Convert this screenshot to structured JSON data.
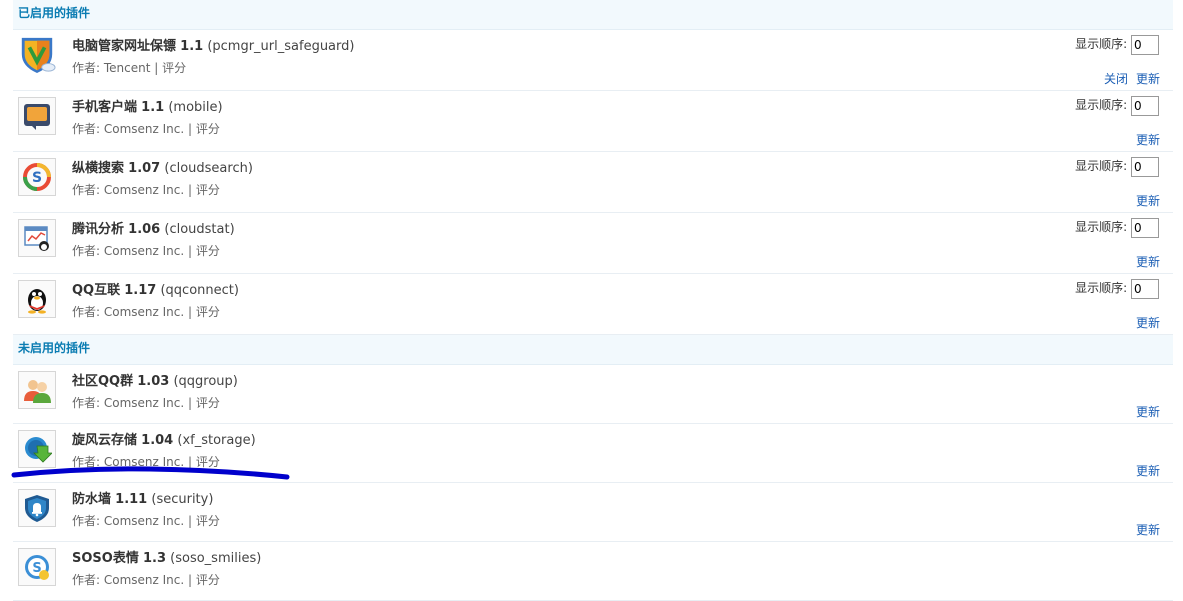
{
  "enabled_section": {
    "title": "已启用的插件"
  },
  "disabled_section": {
    "title": "未启用的插件"
  },
  "labels": {
    "author_prefix": "作者: ",
    "separator": " | ",
    "rating": "评分",
    "order": "显示顺序:",
    "close": "关闭",
    "update": "更新"
  },
  "enabled_plugins": [
    {
      "name": "电脑管家网址保镖",
      "version": "1.1",
      "identifier": "(pcmgr_url_safeguard)",
      "author": "Tencent",
      "order": "0",
      "icon": "shield-icon",
      "show_close": true
    },
    {
      "name": "手机客户端",
      "version": "1.1",
      "identifier": "(mobile)",
      "author": "Comsenz Inc.",
      "order": "0",
      "icon": "mobile-icon",
      "show_close": false
    },
    {
      "name": "纵横搜索",
      "version": "1.07",
      "identifier": "(cloudsearch)",
      "author": "Comsenz Inc.",
      "order": "0",
      "icon": "search-s-icon",
      "show_close": false
    },
    {
      "name": "腾讯分析",
      "version": "1.06",
      "identifier": "(cloudstat)",
      "author": "Comsenz Inc.",
      "order": "0",
      "icon": "analytics-icon",
      "show_close": false
    },
    {
      "name": "QQ互联",
      "version": "1.17",
      "identifier": "(qqconnect)",
      "author": "Comsenz Inc.",
      "order": "0",
      "icon": "qq-penguin-icon",
      "show_close": false
    }
  ],
  "disabled_plugins": [
    {
      "name": "社区QQ群",
      "version": "1.03",
      "identifier": "(qqgroup)",
      "author": "Comsenz Inc.",
      "icon": "group-icon"
    },
    {
      "name": "旋风云存储",
      "version": "1.04",
      "identifier": "(xf_storage)",
      "author": "Comsenz Inc.",
      "icon": "cloud-download-icon"
    },
    {
      "name": "防水墙",
      "version": "1.11",
      "identifier": "(security)",
      "author": "Comsenz Inc.",
      "icon": "security-bell-icon"
    },
    {
      "name": "SOSO表情",
      "version": "1.3",
      "identifier": "(soso_smilies)",
      "author": "Comsenz Inc.",
      "icon": "soso-smiley-icon"
    }
  ],
  "colors": {
    "header_text": "#0a7cb2",
    "header_bg": "#f2f9fd",
    "link": "#1c5fb5",
    "annotation": "#0000cc"
  }
}
